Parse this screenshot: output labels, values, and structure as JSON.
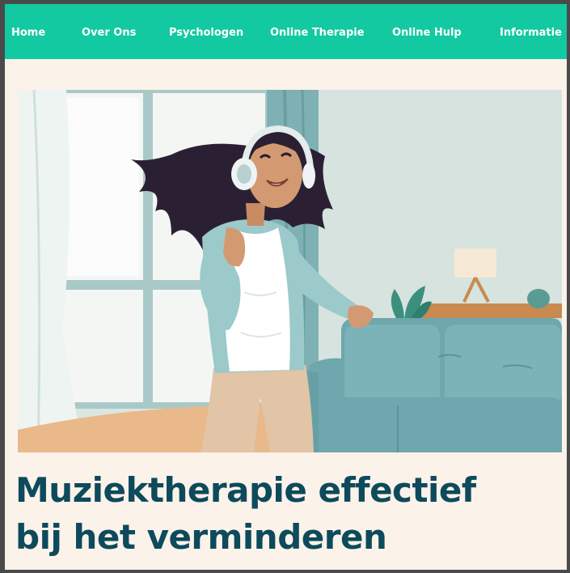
{
  "nav": {
    "items": [
      {
        "label": "Home"
      },
      {
        "label": "Over Ons"
      },
      {
        "label": "Psychologen"
      },
      {
        "label": "Online Therapie"
      },
      {
        "label": "Online Hulp"
      },
      {
        "label": "Informatie"
      }
    ]
  },
  "article": {
    "title_line1": "Muziektherapie effectief",
    "title_line2": "bij het verminderen"
  },
  "colors": {
    "nav_bg": "#12c9a1",
    "page_bg": "#fbf2e9",
    "headline": "#0d4a5c"
  }
}
